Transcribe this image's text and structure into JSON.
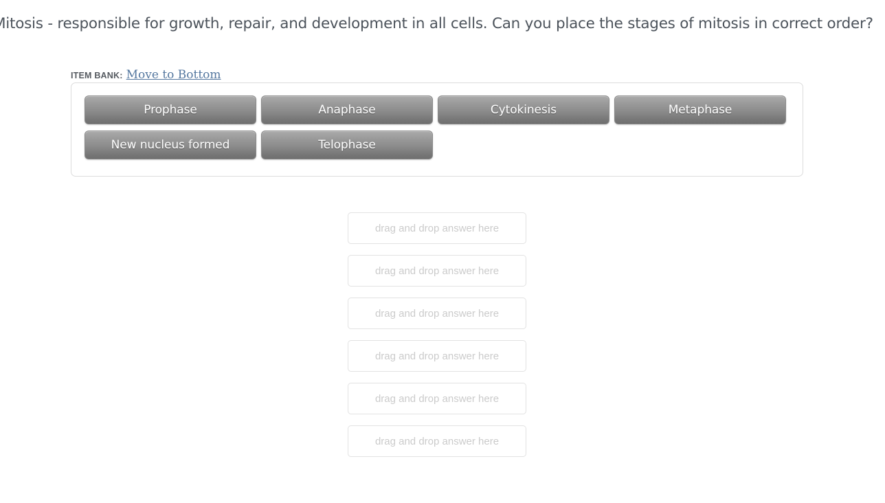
{
  "question": {
    "prompt": "Mitosis - responsible for growth, repair, and development in all cells. Can you place the stages of mitosis in correct order?"
  },
  "item_bank": {
    "label": "ITEM BANK:",
    "move_link": "Move to Bottom",
    "items": [
      {
        "label": "Prophase"
      },
      {
        "label": "Anaphase"
      },
      {
        "label": "Cytokinesis"
      },
      {
        "label": "Metaphase"
      },
      {
        "label": "New nucleus formed"
      },
      {
        "label": "Telophase"
      }
    ]
  },
  "answer_area": {
    "placeholder": "drag and drop answer here",
    "slots": [
      {
        "placeholder": "drag and drop answer here"
      },
      {
        "placeholder": "drag and drop answer here"
      },
      {
        "placeholder": "drag and drop answer here"
      },
      {
        "placeholder": "drag and drop answer here"
      },
      {
        "placeholder": "drag and drop answer here"
      },
      {
        "placeholder": "drag and drop answer here"
      }
    ]
  },
  "colors": {
    "page_background": "#ffffff",
    "prompt_text": "#4c535b",
    "link": "#54779f",
    "chip_gradient_top": "#aaaaaa",
    "chip_gradient_bottom": "#6e6e6e",
    "chip_text": "#ffffff",
    "container_border": "#dcdcdc",
    "dropzone_border": "#e2e2e2",
    "placeholder_text": "#cbcbcb"
  }
}
